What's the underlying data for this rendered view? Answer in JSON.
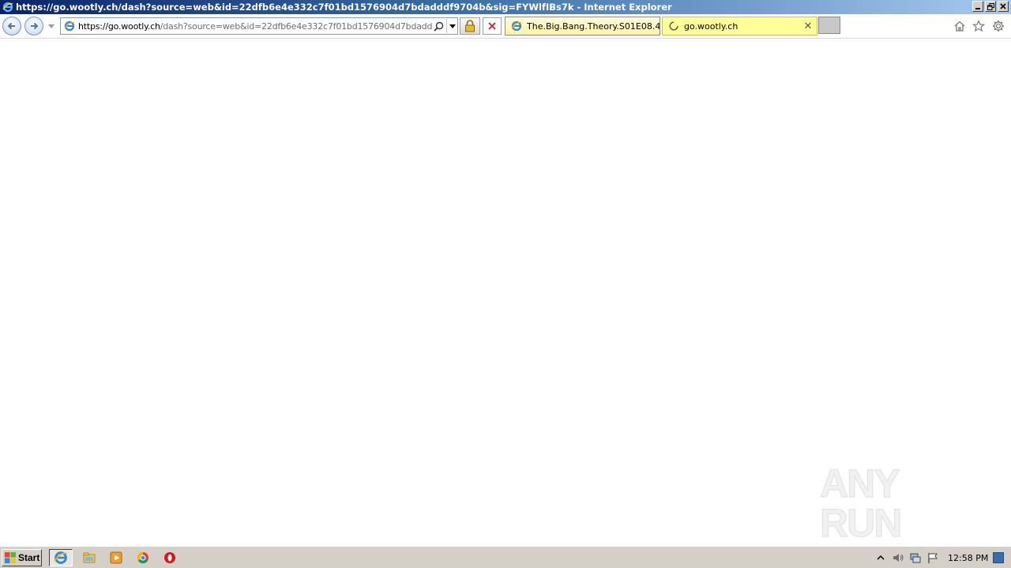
{
  "window": {
    "title": "https://go.wootly.ch/dash?source=web&id=22dfb6e4e332c7f01bd1576904d7bdadddf9704b&sig=FYWlfIBs7k - Internet Explorer",
    "app_icon": "ie-logo-icon",
    "controls": {
      "minimize": "minimize-icon",
      "restore": "restore-icon",
      "close": "close-icon"
    }
  },
  "navbar": {
    "address": {
      "prefix": "https://",
      "domain": "go.wootly.ch",
      "rest": "/dash?source=web&id=22dfb6e4e332c7f01bd1576904d7bdadddf9704b"
    },
    "tabs": [
      {
        "label": "The.Big.Bang.Theory.S01E08.4...",
        "icon": "ie-logo-icon",
        "active": false
      },
      {
        "label": "go.wootly.ch",
        "icon": "loading-icon",
        "active": true
      }
    ],
    "right_icons": [
      "home-icon",
      "favorites-star-icon",
      "gear-icon"
    ]
  },
  "content": {
    "watermark": "ANY RUN"
  },
  "taskbar": {
    "start_label": "Start",
    "apps": [
      "internet-explorer-icon",
      "file-explorer-icon",
      "media-player-icon",
      "chrome-icon",
      "opera-icon"
    ],
    "clock": "12:58 PM",
    "tray_icons": [
      "tray-expand-icon",
      "volume-icon",
      "network-icon",
      "action-center-flag-icon"
    ]
  },
  "colors": {
    "title_start": "#0a246a",
    "title_end": "#a6caf0",
    "tab_active": "#ffff99",
    "taskbar": "#d4d0c8"
  }
}
